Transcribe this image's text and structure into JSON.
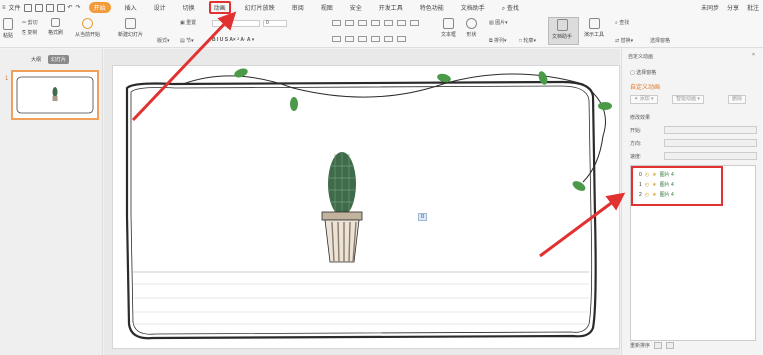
{
  "menu": {
    "file": "文件",
    "tabs": [
      "开始",
      "插入",
      "设计",
      "切换",
      "动画",
      "幻灯片放映",
      "审阅",
      "视图",
      "安全",
      "开发工具",
      "特色功能",
      "文档助手"
    ],
    "active_tab": "开始",
    "highlighted_tab": "动画",
    "search": "查找",
    "right": [
      "未同步",
      "分享",
      "批注"
    ]
  },
  "ribbon": {
    "paste": "粘贴",
    "cut": "剪切",
    "copy": "复制",
    "format_painter": "格式刷",
    "from_current": "从当前开始",
    "new_slide": "新建幻灯片",
    "layout": "版式",
    "reset": "重置",
    "section": "节",
    "font_size": "0",
    "textbox": "文本框",
    "shape": "形状",
    "arrange": "排列",
    "picture": "图片",
    "outline": "轮廓",
    "doc_assist": "文档助手",
    "present": "演示工具",
    "find": "查找",
    "replace": "替换",
    "select": "选择窗格"
  },
  "left_pane": {
    "tab_outline": "大纲",
    "tab_slides": "幻灯片",
    "slide_number": "1"
  },
  "slide": {
    "object_tag": "0"
  },
  "right_pane": {
    "title": "自定义动画",
    "select_pane": "选择窗格",
    "custom_anim": "自定义动画",
    "add_effect": "添加",
    "smart_anim": "智能动画",
    "delete": "删除",
    "modify_effect": "修改效果",
    "start_label": "开始:",
    "direction_label": "方向:",
    "speed_label": "速度:",
    "items": [
      {
        "num": "0",
        "label": "图片 4"
      },
      {
        "num": "1",
        "label": "图片 4"
      },
      {
        "num": "2",
        "label": "图片 4"
      }
    ],
    "reorder": "重新排序"
  },
  "colors": {
    "accent": "#f29b38",
    "highlight": "#e23131",
    "cactus": "#3f6b4a",
    "pot": "#8c7b6b",
    "leaf": "#4a9a4a"
  }
}
